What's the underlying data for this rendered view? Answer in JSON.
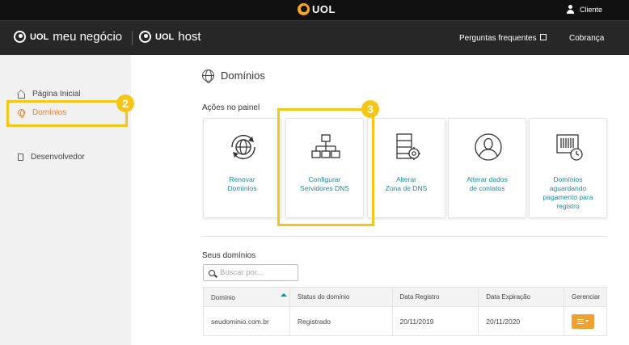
{
  "topbar": {
    "logo": "UOL",
    "client": "Cliente"
  },
  "brandbar": {
    "brand1": {
      "uol": "UOL",
      "name": "meu negócio"
    },
    "brand2": {
      "uol": "UOL",
      "name": "host"
    },
    "nav": [
      "Perguntas frequentes",
      "Cobrança"
    ]
  },
  "sidebar": {
    "items": [
      {
        "label": "Página Inicial",
        "icon": "home-icon",
        "active": false
      },
      {
        "label": "Domínios",
        "icon": "globe-icon",
        "active": true
      },
      {
        "label": "Desenvolvedor",
        "icon": "document-icon",
        "active": false
      }
    ]
  },
  "annotations": {
    "badge_sidebar": "2",
    "badge_card": "3",
    "color": "#f5c518"
  },
  "main": {
    "title": "Domínios",
    "actions_label": "Ações no painel",
    "cards": [
      {
        "label": "Renovar\nDomínios",
        "icon": "renew-globe-icon"
      },
      {
        "label": "Configurar\nServidores DNS",
        "icon": "dns-servers-icon"
      },
      {
        "label": "Alterar\nZona de DNS",
        "icon": "dns-zone-icon"
      },
      {
        "label": "Alterar dados\nde contatos",
        "icon": "contact-icon"
      },
      {
        "label": "Domínios\naguardando\npagamento para\nregistro",
        "icon": "pending-payment-icon"
      }
    ],
    "domains_label": "Seus domínios",
    "search": {
      "placeholder": "Buscar por..."
    },
    "table": {
      "headers": [
        "Domínio",
        "Status do domínio",
        "Data Registro",
        "Data Expiração",
        "Gerenciar"
      ],
      "rows": [
        {
          "domain": "seudominio.com.br",
          "status": "Registrado",
          "registered": "20/11/2019",
          "expires": "20/11/2020"
        }
      ]
    }
  },
  "colors": {
    "accent": "#ec7f2c",
    "link": "#1a8a9e",
    "manage_button": "#f0a030",
    "dark": "#272727"
  }
}
